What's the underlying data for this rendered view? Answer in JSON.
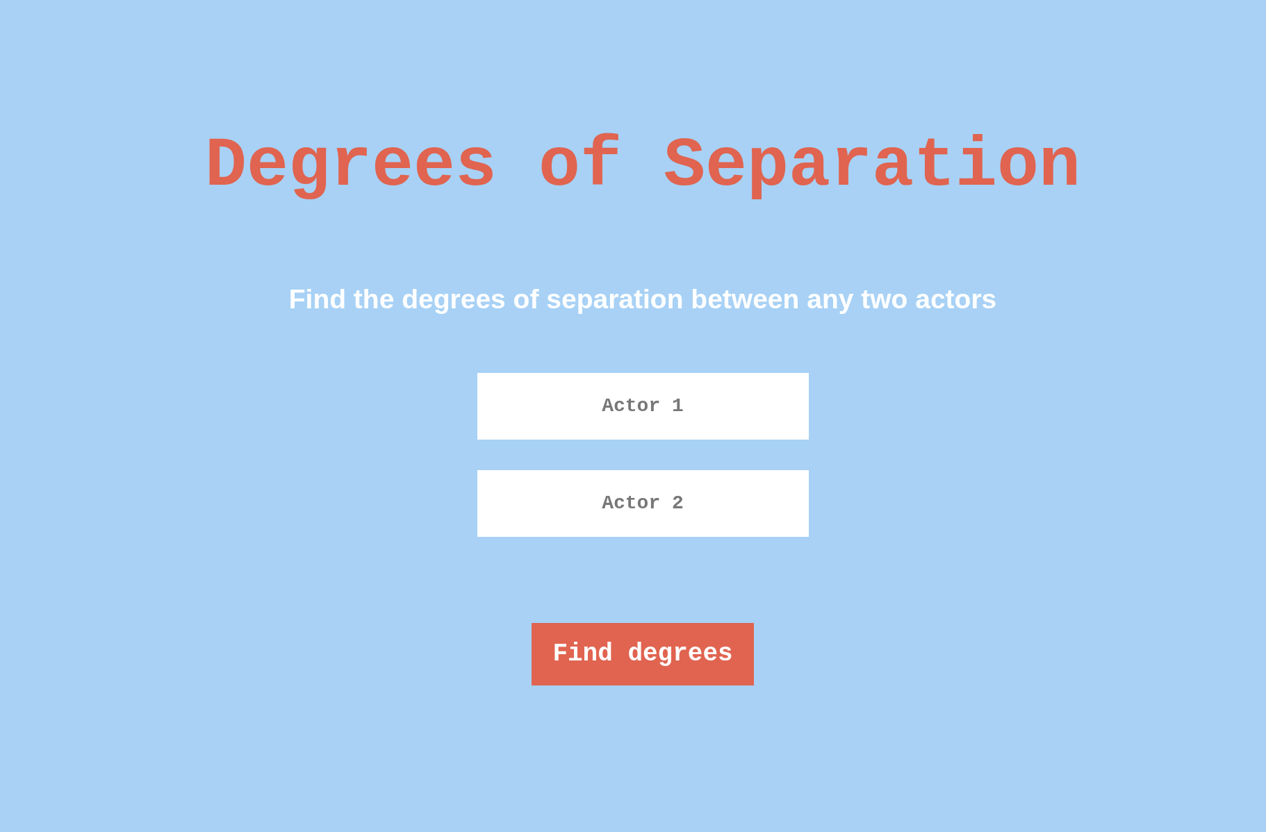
{
  "title": "Degrees of Separation",
  "subtitle": "Find the degrees of separation between any two actors",
  "fields": [
    {
      "placeholder": "Actor 1"
    },
    {
      "placeholder": "Actor 2"
    }
  ],
  "button": {
    "label": "Find degrees"
  }
}
